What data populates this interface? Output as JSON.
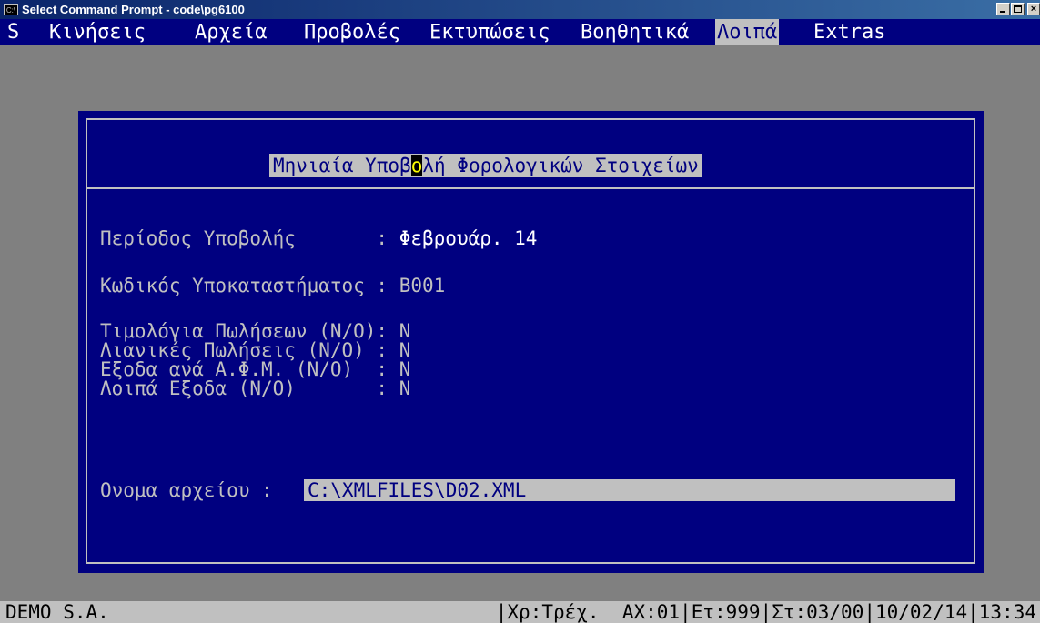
{
  "window": {
    "title": "Select Command Prompt - code\\pg6100",
    "icon_label": "C:\\"
  },
  "menu": {
    "items": [
      {
        "label": "S",
        "active": false
      },
      {
        "label": "Κινήσεις",
        "active": false
      },
      {
        "label": "Αρχεία",
        "active": false
      },
      {
        "label": "Προβολές",
        "active": false
      },
      {
        "label": "Εκτυπώσεις",
        "active": false
      },
      {
        "label": "Βοηθητικά",
        "active": false
      },
      {
        "label": "Λοιπά",
        "active": true
      },
      {
        "label": "Extras",
        "active": false
      }
    ]
  },
  "dialog": {
    "title_before": "Μηνιαία Υποβ",
    "title_cursor": "ο",
    "title_after": "λή Φορολογικών Στοιχείων",
    "period_label": "Περίοδος Υποβολής       : ",
    "period_value": "Φεβρουάρ. 14",
    "branch_label": "Κωδικός Υποκαταστήματος : ",
    "branch_value": "B001",
    "invoices_line": "Τιμολόγια Πωλήσεων (Ν/Ο): N",
    "retail_line": "Λιανικές Πωλήσεις (Ν/Ο) : N",
    "expenses_afm_line": "Εξοδα ανά Α.Φ.Μ. (Ν/Ο)  : N",
    "other_expenses_line": "Λοιπά Εξοδα (Ν/Ο)       : N",
    "filename_label": "Ονομα αρχείου : ",
    "filename_value": "C:\\XMLFILES\\D02.XML"
  },
  "statusbar": {
    "company": "DEMO S.A.",
    "info": "|Χρ:Τρέχ.  ΑΧ:01|Ετ:999|Στ:03/00|10/02/14|13:34"
  },
  "colors": {
    "console_bg": "#808080",
    "panel_bg": "#000080",
    "highlight_bg": "#c0c0c0",
    "cursor_fg": "#ffff00"
  }
}
